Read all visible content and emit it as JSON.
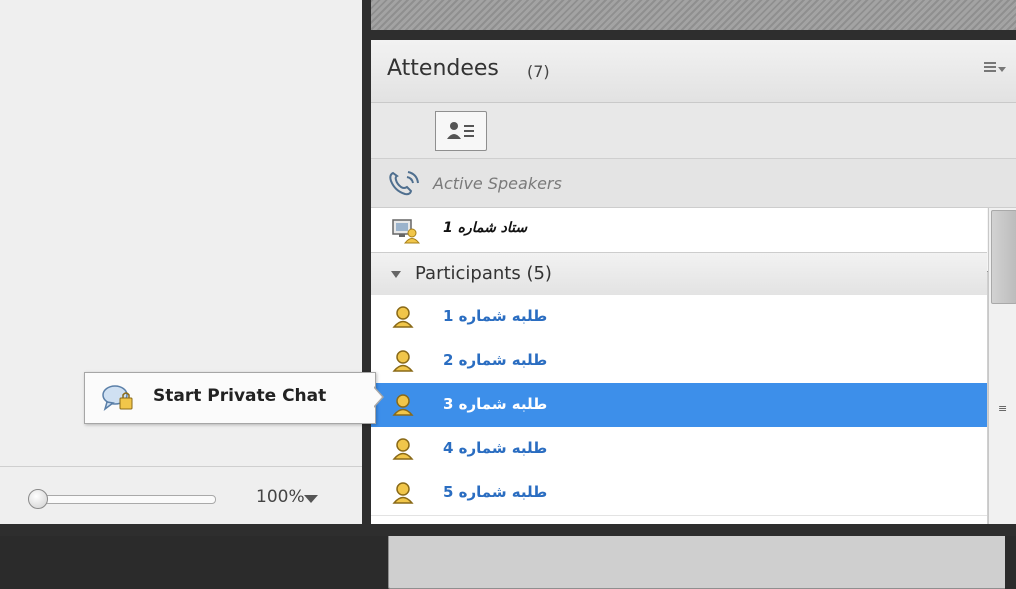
{
  "zoom": {
    "value": "100%"
  },
  "pod": {
    "title": "Attendees",
    "count": "(7)"
  },
  "speakers": {
    "label": "Active Speakers"
  },
  "host": {
    "name": "ستاد شماره 1"
  },
  "group": {
    "label": "Participants (5)"
  },
  "participants": [
    {
      "name": "طلبه  شماره 1"
    },
    {
      "name": "طلبه شماره 2"
    },
    {
      "name": "طلبه شماره 3"
    },
    {
      "name": "طلبه شماره 4"
    },
    {
      "name": "طلبه شماره 5"
    }
  ],
  "popup": {
    "label": "Start Private Chat"
  },
  "colors": {
    "selection": "#3d8fea",
    "link": "#2a6dc1"
  },
  "icons": {
    "menu": "menu-icon",
    "list_view": "list-view-icon",
    "role_view": "role-view-icon",
    "speakers": "phone-icon",
    "host": "host-presenter-icon",
    "participant": "user-icon",
    "chat": "private-chat-icon"
  }
}
